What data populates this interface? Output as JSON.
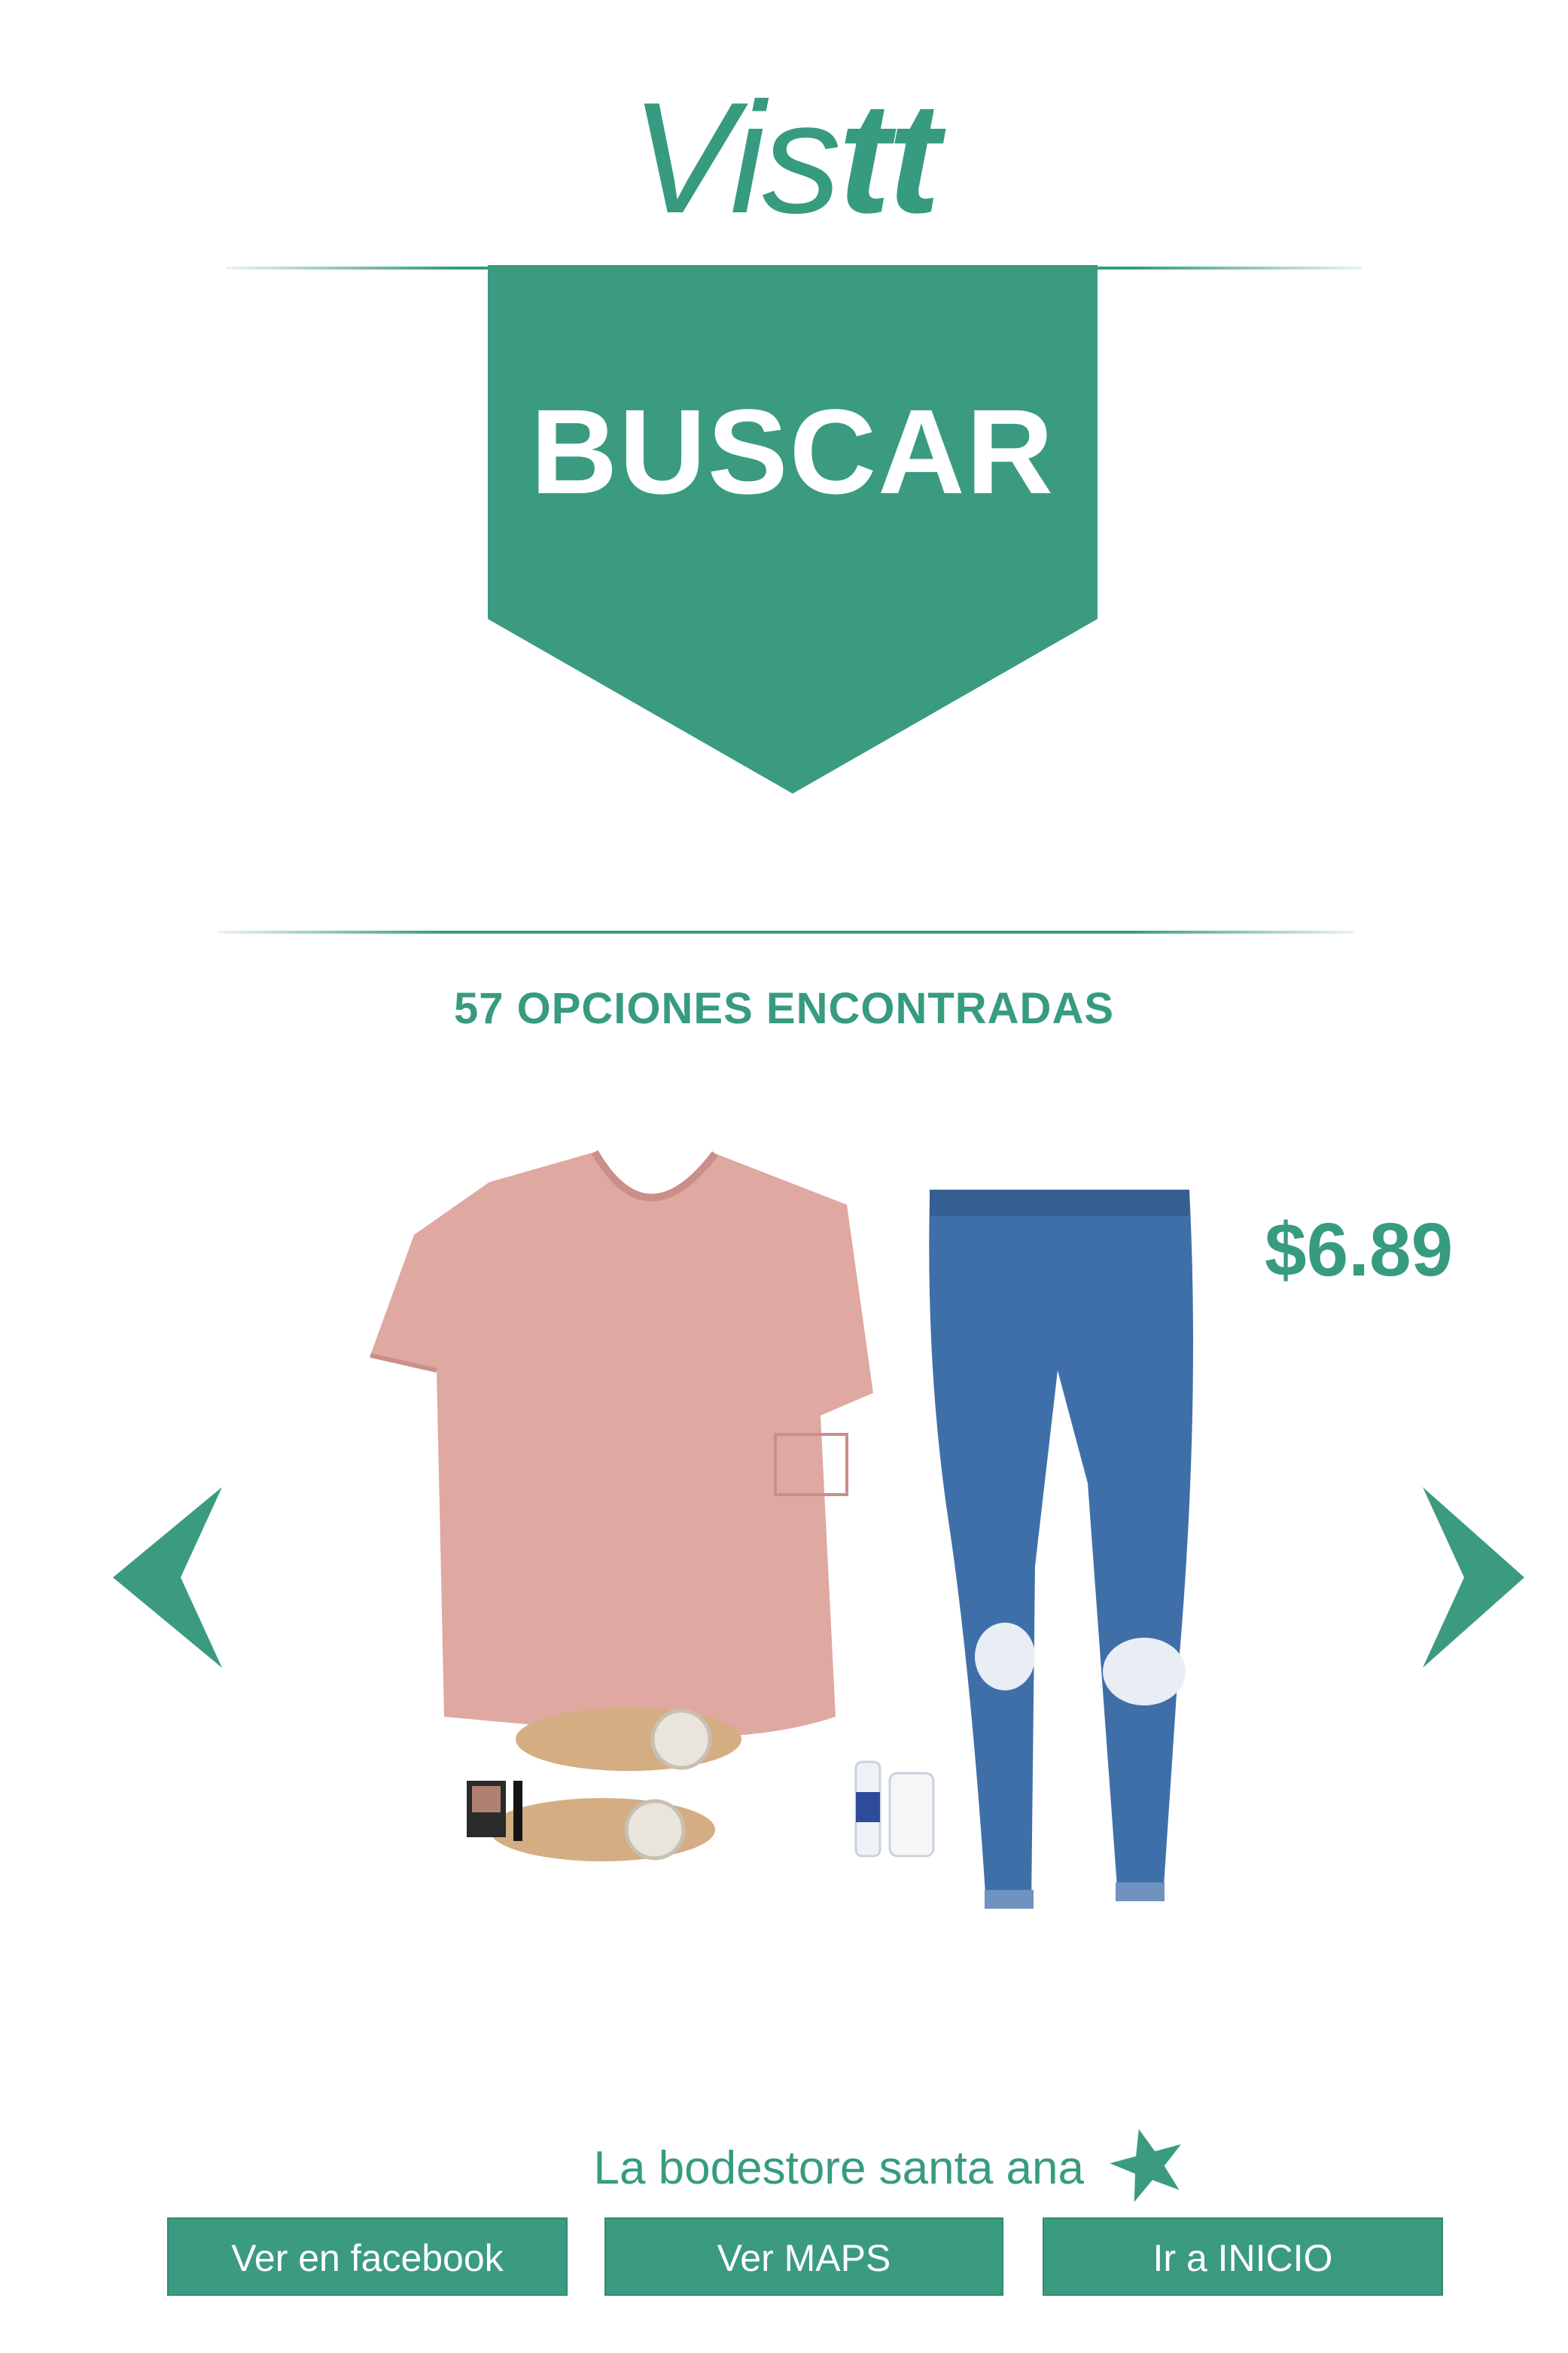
{
  "header": {
    "logo_part1": "Vis",
    "logo_part2": "tt"
  },
  "banner": {
    "label": "BUSCAR"
  },
  "results": {
    "count_text": "57 OPCIONES ENCONTRADAS"
  },
  "product": {
    "price": "$6.89",
    "image_items": [
      "pink t-shirt",
      "blue ripped jeans",
      "sandals",
      "eyeshadow palette",
      "mascara",
      "water bottle",
      "phone case"
    ]
  },
  "carousel": {
    "prev_icon": "chevron-left-icon",
    "next_icon": "chevron-right-icon"
  },
  "footer": {
    "store_name": "La bodestore santa ana",
    "star_icon": "star-icon",
    "buttons": [
      {
        "label": "Ver en facebook"
      },
      {
        "label": "Ver MAPS"
      },
      {
        "label": "Ir  a INICIO"
      }
    ]
  },
  "colors": {
    "accent": "#379b80",
    "background": "#ffffff",
    "shirt": "#e0a9a2",
    "denim": "#3f6fa8"
  }
}
